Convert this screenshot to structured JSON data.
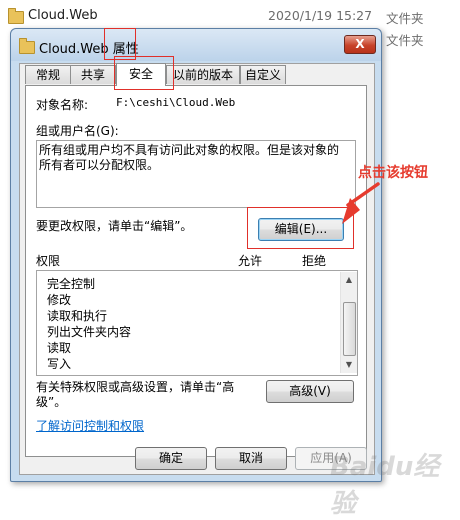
{
  "background_list": {
    "rows": [
      {
        "name": "Cloud.Web",
        "date": "2020/1/19 15:27",
        "type": "文件夹"
      },
      {
        "name": "",
        "date": "",
        "type": "文件夹"
      }
    ]
  },
  "dialog": {
    "title_name": "Cloud.Web",
    "title_suffix": "属性",
    "close_label": "X",
    "tabs": [
      {
        "label": "常规"
      },
      {
        "label": "共享"
      },
      {
        "label": "安全"
      },
      {
        "label": "以前的版本"
      },
      {
        "label": "自定义"
      }
    ],
    "object_name_label": "对象名称:",
    "object_name_value": "F:\\ceshi\\Cloud.Web",
    "group_label": "组或用户名(G):",
    "group_message": "所有组或用户均不具有访问此对象的权限。但是该对象的所有者可以分配权限。",
    "change_hint": "要更改权限，请单击“编辑”。",
    "edit_button": "编辑(E)...",
    "permissions_label": "权限",
    "allow_label": "允许",
    "deny_label": "拒绝",
    "permissions": [
      "完全控制",
      "修改",
      "读取和执行",
      "列出文件夹内容",
      "读取",
      "写入"
    ],
    "advanced_hint": "有关特殊权限或高级设置，请单击“高级”。",
    "advanced_button": "高级(V)",
    "learn_link": "了解访问控制和权限",
    "ok_button": "确定",
    "cancel_button": "取消",
    "apply_button": "应用(A)"
  },
  "annotation": {
    "text": "点击该按钮",
    "color": "#e63b2e"
  },
  "watermark": "Baidu经验",
  "colors": {
    "dialog_frame": "#c7dcef",
    "link": "#0066cc",
    "close_button": "#c7432a"
  }
}
